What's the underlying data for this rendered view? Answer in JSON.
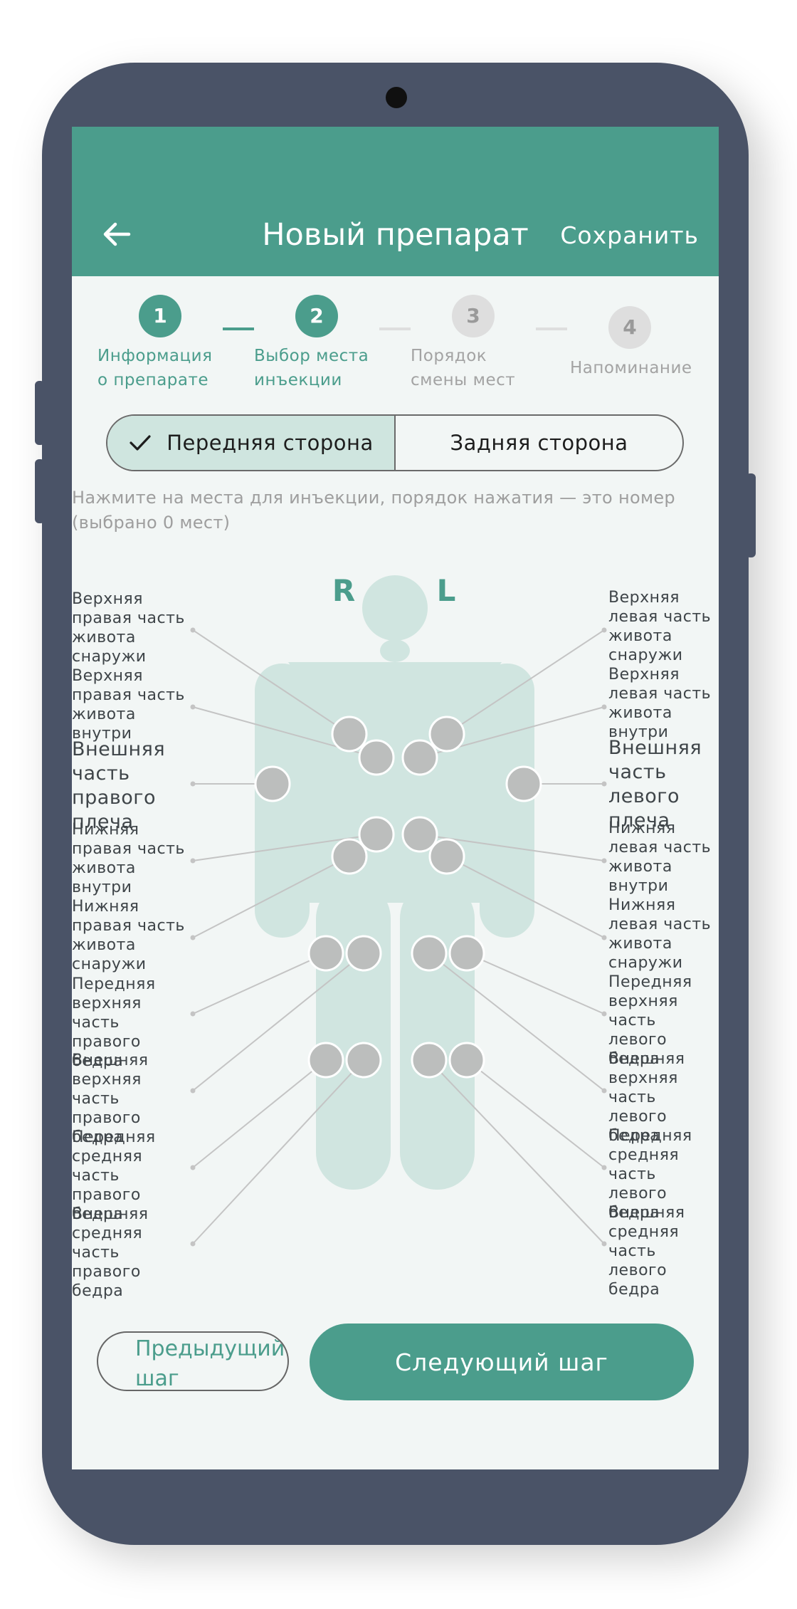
{
  "header": {
    "title": "Новый препарат",
    "save_label": "Сохранить"
  },
  "steps": [
    {
      "number": "1",
      "label_line1": "Информация",
      "label_line2": "о препарате",
      "state": "done"
    },
    {
      "number": "2",
      "label_line1": "Выбор места",
      "label_line2": "инъекции",
      "state": "done"
    },
    {
      "number": "3",
      "label_line1": "Порядок",
      "label_line2": "смены мест",
      "state": "todo"
    },
    {
      "number": "4",
      "label_line1": "Напоминание",
      "label_line2": "",
      "state": "todo"
    }
  ],
  "side_toggle": {
    "front_label": "Передняя сторона",
    "back_label": "Задняя сторона",
    "selected": "front"
  },
  "hint": {
    "line1": "Нажмите на места для инъекции, порядок нажатия — это номер",
    "line2": "(выбрано 0 мест)"
  },
  "body_letters": {
    "right": "R",
    "left": "L"
  },
  "sites_left": [
    "Верхняя правая часть живота снаружи",
    "Верхняя правая часть живота внутри",
    "Внешняя часть правого плеча",
    "Нижняя правая часть живота внутри",
    "Нижняя правая часть живота снаружи",
    "Передняя верхняя часть правого бедра",
    "Внешняя верхняя часть правого бедра",
    "Передняя средняя часть правого бедра",
    "Внешняя средняя часть правого бедра"
  ],
  "sites_right": [
    "Верхняя левая часть живота снаружи",
    "Верхняя левая часть живота внутри",
    "Внешняя часть левого плеча",
    "Нижняя левая часть живота внутри",
    "Нижняя левая часть живота снаружи",
    "Передняя верхняя часть левого бедра",
    "Внешняя верхняя часть левого бедра",
    "Передняя средняя часть левого бедра",
    "Внешняя средняя часть левого бедра"
  ],
  "buttons": {
    "prev_label": "Предыдущий шаг",
    "next_label": "Следующий шаг"
  },
  "colors": {
    "primary": "#4b9d8c",
    "frame": "#4a5367",
    "body_silhouette": "#d0e5e0",
    "site_dot": "#bcbebd"
  }
}
